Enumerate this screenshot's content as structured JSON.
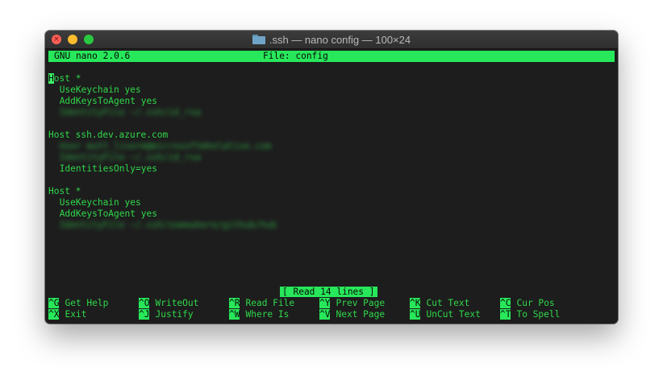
{
  "window": {
    "title": ".ssh — nano config — 100×24",
    "close_glyph": "×"
  },
  "nano": {
    "version": "GNU nano 2.0.6",
    "file": "File: config",
    "status": "[ Read 14 lines ]"
  },
  "lines": [
    {
      "text": "Host *",
      "indent": 0
    },
    {
      "text": "UseKeychain yes",
      "indent": 2
    },
    {
      "text": "AddKeysToAgent yes",
      "indent": 2
    },
    {
      "text": "IdentityFile ~/.ssh/id_rsa",
      "indent": 2,
      "blurred": true
    },
    {
      "text": "",
      "indent": 0
    },
    {
      "text": "Host ssh.dev.azure.com",
      "indent": 0
    },
    {
      "text": "User mutt_liverm@microsoftmhelative.com",
      "indent": 2,
      "blurred": true
    },
    {
      "text": "IdentityFile ~/.ssh/id_rsa",
      "indent": 2,
      "blurred": true
    },
    {
      "text": "IdentitiesOnly=yes",
      "indent": 2
    },
    {
      "text": "",
      "indent": 0
    },
    {
      "text": "Host *",
      "indent": 0
    },
    {
      "text": "UseKeychain yes",
      "indent": 2
    },
    {
      "text": "AddKeysToAgent yes",
      "indent": 2
    },
    {
      "text": "IdentityFile ~/.ssh/somewhere/github/hub",
      "indent": 2,
      "blurred": true
    }
  ],
  "shortcuts": [
    [
      {
        "key": "^G",
        "label": "Get Help",
        "icon": "help-icon"
      },
      {
        "key": "^O",
        "label": "WriteOut",
        "icon": "write-icon"
      },
      {
        "key": "^R",
        "label": "Read File",
        "icon": "read-icon"
      },
      {
        "key": "^Y",
        "label": "Prev Page",
        "icon": "prev-page-icon"
      },
      {
        "key": "^K",
        "label": "Cut Text",
        "icon": "cut-icon"
      },
      {
        "key": "^C",
        "label": "Cur Pos",
        "icon": "position-icon"
      }
    ],
    [
      {
        "key": "^X",
        "label": "Exit",
        "icon": "exit-icon"
      },
      {
        "key": "^J",
        "label": "Justify",
        "icon": "justify-icon"
      },
      {
        "key": "^W",
        "label": "Where Is",
        "icon": "search-icon"
      },
      {
        "key": "^V",
        "label": "Next Page",
        "icon": "next-page-icon"
      },
      {
        "key": "^U",
        "label": "UnCut Text",
        "icon": "paste-icon"
      },
      {
        "key": "^T",
        "label": "To Spell",
        "icon": "spell-icon"
      }
    ]
  ],
  "colors": {
    "terminal_bg": "#1d1d1d",
    "nano_green": "#27e85a",
    "text_green": "#2fd84a"
  }
}
